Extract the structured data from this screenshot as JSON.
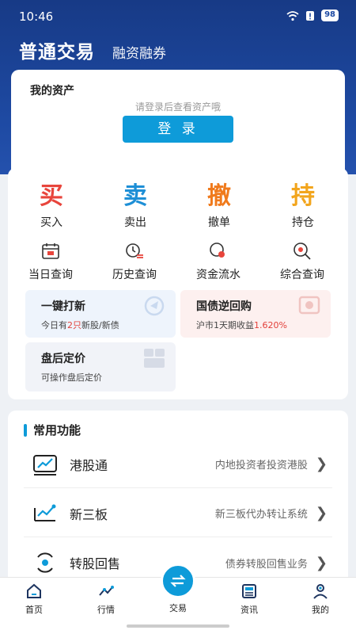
{
  "status": {
    "time": "10:46",
    "battery": "98"
  },
  "tabs": {
    "main": "普通交易",
    "sub": "融资融券"
  },
  "asset": {
    "title": "我的资产",
    "hint": "请登录后查看资产哦",
    "login_label": "登 录"
  },
  "quick_actions": [
    {
      "label": "买入",
      "glyph": "买",
      "color": "#e8453c"
    },
    {
      "label": "卖出",
      "glyph": "卖",
      "color": "#1e8fd6"
    },
    {
      "label": "撤单",
      "glyph": "撤",
      "color": "#f07a1c"
    },
    {
      "label": "持仓",
      "glyph": "持",
      "color": "#f2a51d"
    }
  ],
  "queries": [
    {
      "label": "当日查询"
    },
    {
      "label": "历史查询"
    },
    {
      "label": "资金流水"
    },
    {
      "label": "综合查询"
    }
  ],
  "features": {
    "ipo": {
      "title": "一键打新",
      "sub_pre": "今日有",
      "sub_count": "2只",
      "sub_post": "新股/新债"
    },
    "repo": {
      "title": "国债逆回购",
      "sub_pre": "沪市1天期收益",
      "sub_rate": "1.620%"
    },
    "after_hours": {
      "title": "盘后定价",
      "sub": "可操作盘后定价"
    }
  },
  "common": {
    "title": "常用功能",
    "items": [
      {
        "name": "港股通",
        "desc": "内地投资者投资港股"
      },
      {
        "name": "新三板",
        "desc": "新三板代办转让系统"
      },
      {
        "name": "转股回售",
        "desc": "债券转股回售业务"
      }
    ]
  },
  "nav": {
    "home": "首页",
    "market": "行情",
    "trade": "交易",
    "news": "资讯",
    "mine": "我的"
  },
  "colors": {
    "primary": "#1e4aa3",
    "accent": "#0e9bd9",
    "highlight": "#e2403a"
  }
}
